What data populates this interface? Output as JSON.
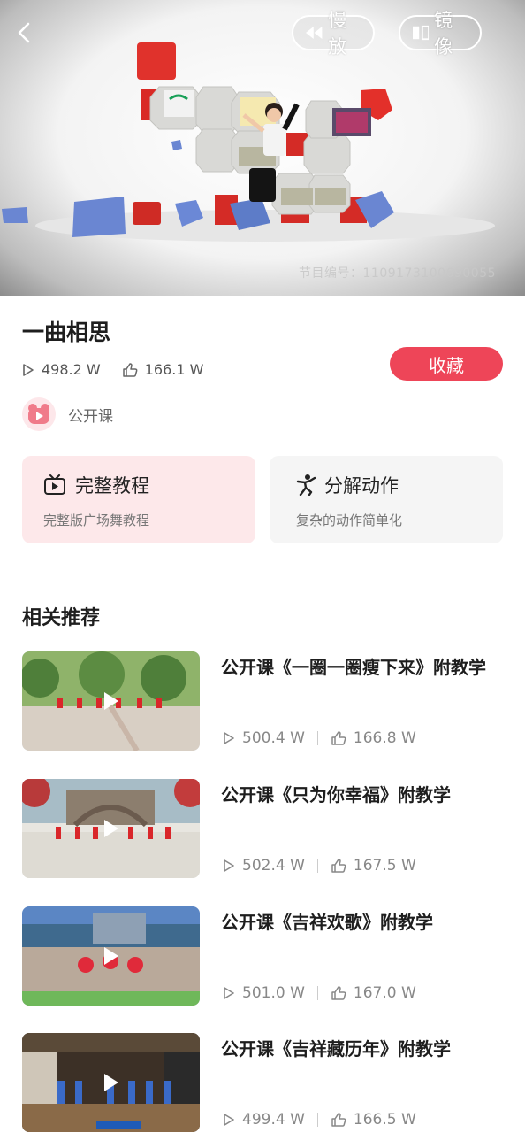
{
  "player": {
    "slow_label": "慢放",
    "mirror_label": "镜像",
    "watermark": "节目编号：1109173100690055"
  },
  "video": {
    "title": "一曲相思",
    "plays": "498.2 W",
    "likes": "166.1 W",
    "favorite_label": "收藏",
    "author": "公开课"
  },
  "modes": [
    {
      "title": "完整教程",
      "subtitle": "完整版广场舞教程"
    },
    {
      "title": "分解动作",
      "subtitle": "复杂的动作简单化"
    }
  ],
  "recommend": {
    "section_title": "相关推荐",
    "items": [
      {
        "title": "公开课《一圈一圈瘦下来》附教学",
        "plays": "500.4 W",
        "likes": "166.8 W"
      },
      {
        "title": "公开课《只为你幸福》附教学",
        "plays": "502.4 W",
        "likes": "167.5 W"
      },
      {
        "title": "公开课《吉祥欢歌》附教学",
        "plays": "501.0 W",
        "likes": "167.0 W"
      },
      {
        "title": "公开课《吉祥藏历年》附教学",
        "plays": "499.4 W",
        "likes": "166.5 W"
      }
    ]
  },
  "colors": {
    "accent": "#ee4558",
    "card_full_bg": "#fde8ea",
    "card_split_bg": "#f5f5f5"
  }
}
